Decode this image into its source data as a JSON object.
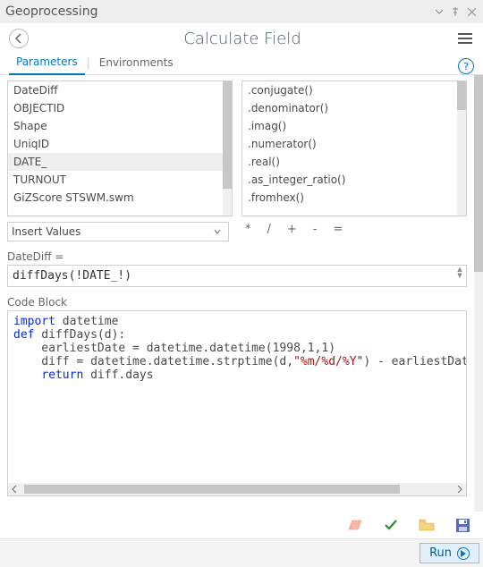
{
  "header": {
    "title": "Geoprocessing"
  },
  "toolbar": {
    "tool_name": "Calculate Field"
  },
  "tabs": {
    "parameters": "Parameters",
    "environments": "Environments",
    "active": "parameters"
  },
  "fields_list": {
    "items": [
      "DateDiff",
      "OBJECTID",
      "Shape",
      "UniqID",
      "DATE_",
      "TURNOUT",
      "GiZScore STSWM.swm"
    ],
    "selected_index": 4
  },
  "helpers_list": {
    "items": [
      ".conjugate()",
      ".denominator()",
      ".imag()",
      ".numerator()",
      ".real()",
      ".as_integer_ratio()",
      ".fromhex()"
    ]
  },
  "insert_values": {
    "label": "Insert Values"
  },
  "operators": [
    "*",
    "/",
    "+",
    "-",
    "="
  ],
  "expr_label": "DateDiff =",
  "expression": "diffDays(!DATE_!)",
  "code_block_label": "Code Block",
  "code_lines": [
    {
      "t": "import",
      "cls": "kw"
    },
    {
      "t": " datetime\n",
      "cls": ""
    },
    {
      "t": "def",
      "cls": "kw"
    },
    {
      "t": " diffDays(d):\n",
      "cls": ""
    },
    {
      "t": "    earliestDate = datetime.datetime(1998,1,1)\n",
      "cls": ""
    },
    {
      "t": "    diff = datetime.datetime.strptime(d,",
      "cls": ""
    },
    {
      "t": "\"%m/%d/%Y\"",
      "cls": "str"
    },
    {
      "t": ") - earliestDate\n",
      "cls": ""
    },
    {
      "t": "    ",
      "cls": ""
    },
    {
      "t": "return",
      "cls": "kw"
    },
    {
      "t": " diff.days",
      "cls": ""
    }
  ],
  "action_icons": {
    "eraser": "eraser-icon",
    "check": "check-icon",
    "folder": "folder-icon",
    "save": "save-icon"
  },
  "run_label": "Run"
}
